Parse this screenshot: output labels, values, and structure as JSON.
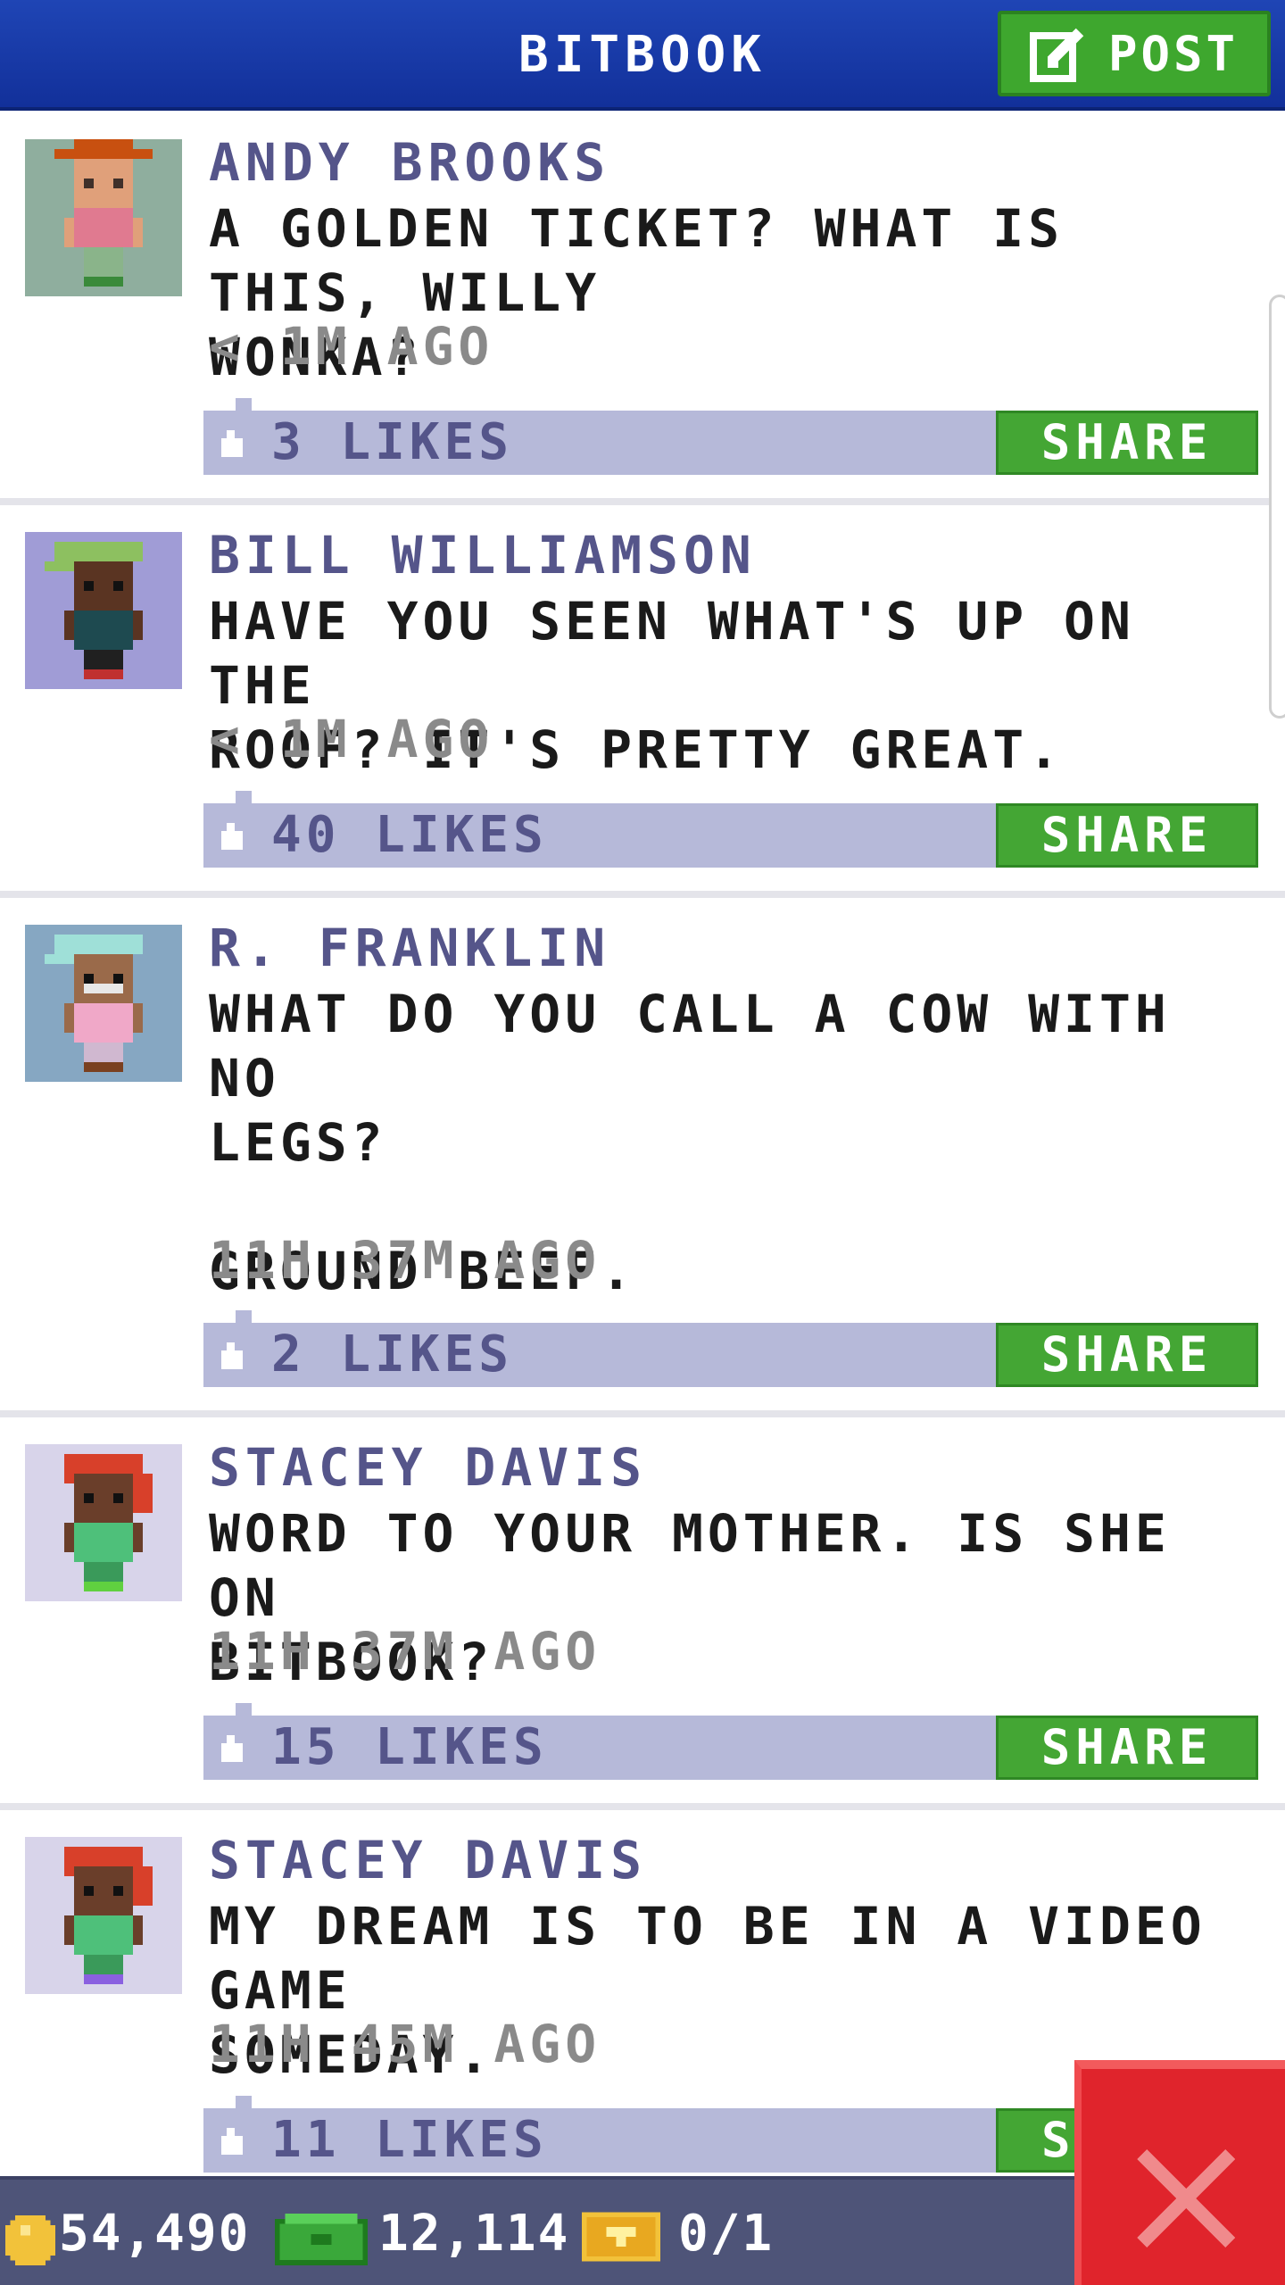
{
  "header": {
    "title": "BITBOOK",
    "post_label": "POST"
  },
  "feed": {
    "posts": [
      {
        "author": "ANDY BROOKS",
        "message": "A GOLDEN TICKET? WHAT IS THIS, WILLY\nWONKA?",
        "time": "< 1M AGO",
        "likes": "3 LIKES",
        "share_label": "SHARE"
      },
      {
        "author": "BILL WILLIAMSON",
        "message": "HAVE YOU SEEN WHAT'S UP ON THE\nROOF? IT'S PRETTY GREAT.",
        "time": "< 1M AGO",
        "likes": "40 LIKES",
        "share_label": "SHARE"
      },
      {
        "author": "R. FRANKLIN",
        "message": "WHAT DO YOU CALL A COW WITH NO\nLEGS?\n\nGROUND BEEF.",
        "time": "11H 37M AGO",
        "likes": "2 LIKES",
        "share_label": "SHARE"
      },
      {
        "author": "STACEY DAVIS",
        "message": "WORD TO YOUR MOTHER. IS SHE ON\nBITBOOK?",
        "time": "11H 37M AGO",
        "likes": "15 LIKES",
        "share_label": "SHARE"
      },
      {
        "author": "STACEY DAVIS",
        "message": "MY DREAM IS TO BE IN A VIDEO GAME\nSOMEDAY.",
        "time": "11H 45M AGO",
        "likes": "11 LIKES",
        "share_label": "S"
      }
    ]
  },
  "bottom_bar": {
    "coins": "54,490",
    "bux": "12,114",
    "tickets": "0/1"
  },
  "colors": {
    "header_blue": "#1a3ca8",
    "post_green": "#3ea72e",
    "author_purple": "#55558a",
    "likes_bar": "#b6b9d9",
    "close_red": "#e0242c"
  },
  "icons": {
    "post": "edit-icon",
    "like": "thumbs-up-icon",
    "coin": "coin-icon",
    "bux": "bux-icon",
    "ticket": "ticket-icon",
    "close": "close-icon"
  }
}
